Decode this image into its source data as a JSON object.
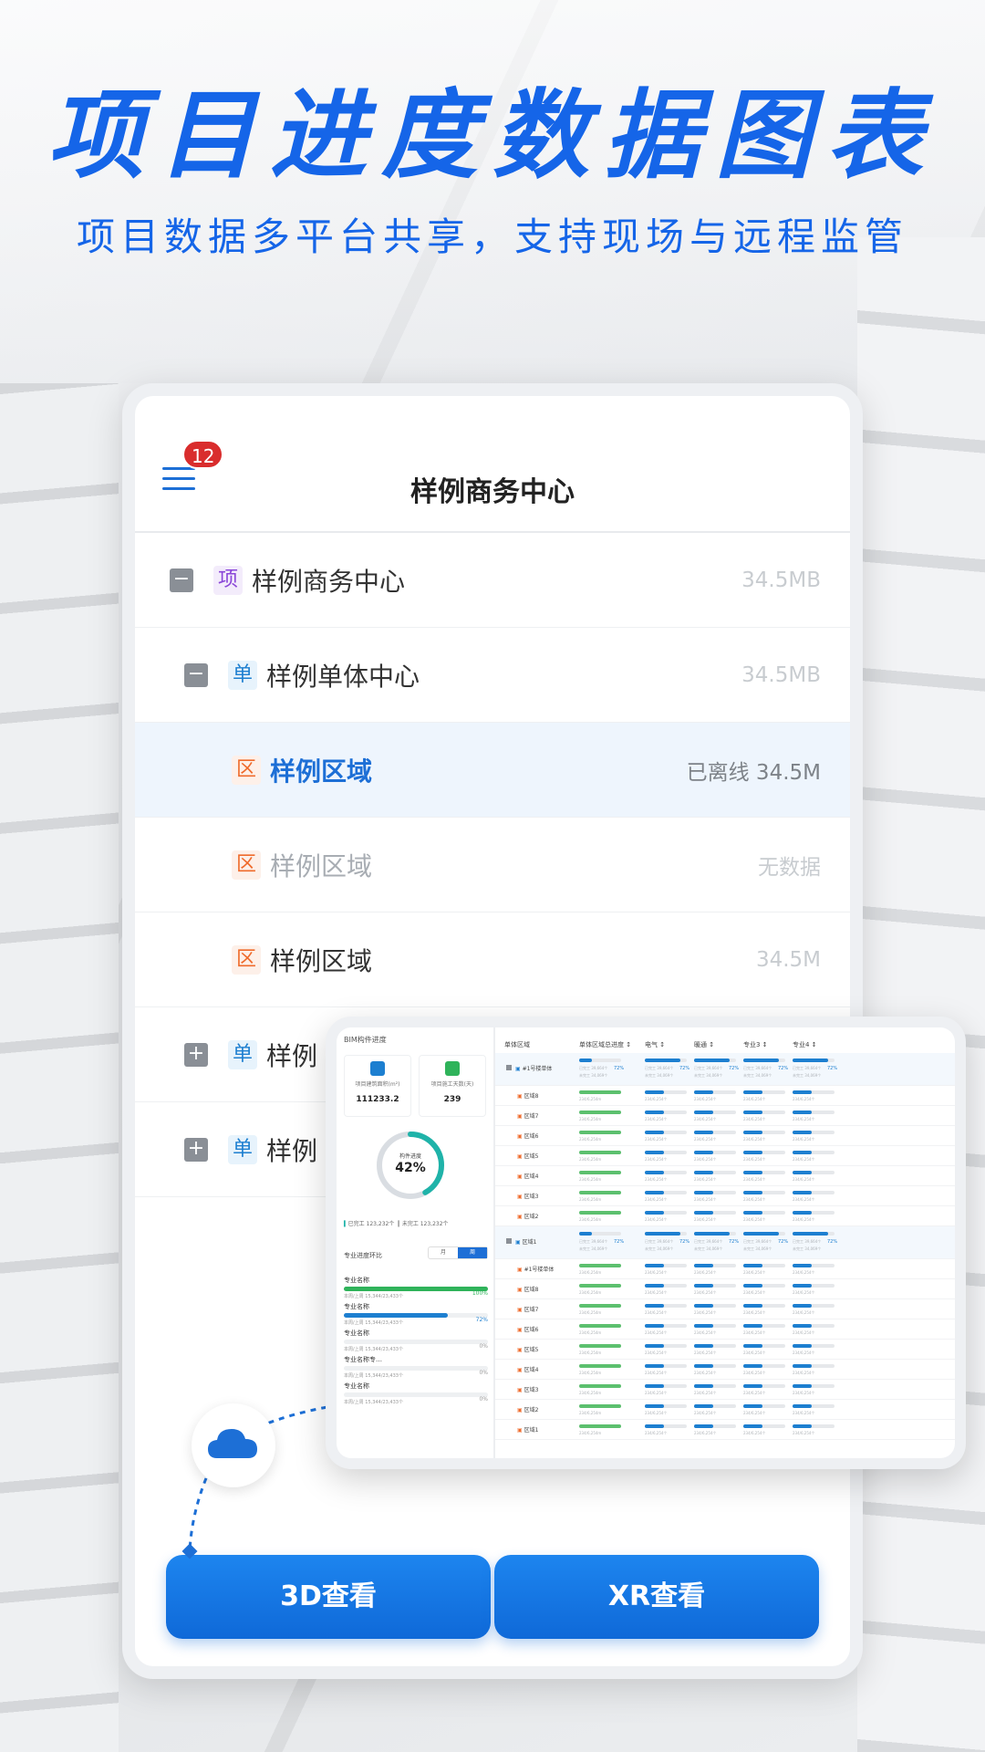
{
  "hero": {
    "title": "项目进度数据图表",
    "subtitle": "项目数据多平台共享，支持现场与远程监管"
  },
  "app": {
    "title": "样例商务中心",
    "notification_count": "12",
    "tree": [
      {
        "tag": "项",
        "label": "样例商务中心",
        "meta": "34.5MB",
        "toggle": "−",
        "state": "normal"
      },
      {
        "tag": "单",
        "label": "样例单体中心",
        "meta": "34.5MB",
        "toggle": "−",
        "state": "normal"
      },
      {
        "tag": "区",
        "label": "样例区域",
        "meta": "已离线 34.5M",
        "state": "active"
      },
      {
        "tag": "区",
        "label": "样例区域",
        "meta": "无数据",
        "state": "muted"
      },
      {
        "tag": "区",
        "label": "样例区域",
        "meta": "34.5M",
        "state": "normal"
      },
      {
        "tag": "单",
        "label": "样例",
        "toggle": "+",
        "state": "normal"
      },
      {
        "tag": "单",
        "label": "样例",
        "toggle": "+",
        "state": "normal"
      }
    ],
    "buttons": {
      "view3d": "3D查看",
      "viewxr": "XR查看"
    }
  },
  "dashboard": {
    "title": "BIM构件进度",
    "kpis": [
      {
        "label": "项目建筑面积(m²)",
        "value": "111233.2"
      },
      {
        "label": "项目施工天数(天)",
        "value": "239"
      }
    ],
    "donut": {
      "label": "构件进度",
      "value": "42%",
      "percent": 42
    },
    "legend": {
      "done": "已完工 123,232个",
      "undone": "未完工 123,232个"
    },
    "progress_title": "专业进度环比",
    "segments": [
      "月",
      "周"
    ],
    "progress_items": [
      {
        "name": "专业名称",
        "sub": "本周/上周 15,344/23,433个",
        "pct": "100%",
        "value": 1.0,
        "color": "#2fb35a"
      },
      {
        "name": "专业名称",
        "sub": "本周/上周 15,344/23,433个",
        "pct": "72%",
        "value": 0.72,
        "color": "#1d7fd0"
      },
      {
        "name": "专业名称",
        "sub": "本周/上周 15,344/23,433个",
        "pct": "0%",
        "value": 0,
        "color": "#1d7fd0"
      },
      {
        "name": "专业名称专…",
        "sub": "本周/上周 15,344/23,433个",
        "pct": "0%",
        "value": 0,
        "color": "#1d7fd0"
      },
      {
        "name": "专业名称",
        "sub": "本周/上周 15,344/23,433个",
        "pct": "0%",
        "value": 0,
        "color": "#1d7fd0"
      }
    ],
    "table": {
      "headers": [
        "单体区域",
        "单体区域总进度 ↕",
        "电气 ↕",
        "暖通 ↕",
        "专业3 ↕",
        "专业4 ↕"
      ],
      "group_pct": "72%",
      "group_done": "已完工 39,664个",
      "group_undone": "未完工 34,069个",
      "cell_sub": "234/6,254m",
      "cell_sub2": "234/6,254个",
      "rows": [
        {
          "name": "#1号楼单体",
          "group": true
        },
        {
          "name": "区域8"
        },
        {
          "name": "区域7"
        },
        {
          "name": "区域6"
        },
        {
          "name": "区域5"
        },
        {
          "name": "区域4"
        },
        {
          "name": "区域3"
        },
        {
          "name": "区域2"
        },
        {
          "name": "区域1",
          "group": true
        },
        {
          "name": "#1号楼单体"
        },
        {
          "name": "区域8"
        },
        {
          "name": "区域7"
        },
        {
          "name": "区域6"
        },
        {
          "name": "区域5"
        },
        {
          "name": "区域4"
        },
        {
          "name": "区域3"
        },
        {
          "name": "区域2"
        },
        {
          "name": "区域1"
        }
      ]
    }
  },
  "colors": {
    "accent": "#1565e8",
    "primary_button": "#1d85ef",
    "green": "#2fb35a",
    "teal": "#1fb3a9"
  }
}
